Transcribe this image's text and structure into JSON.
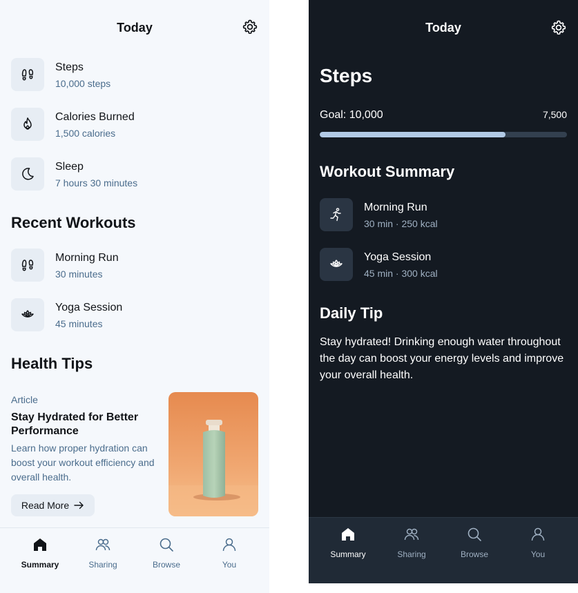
{
  "light": {
    "title": "Today",
    "metrics": [
      {
        "icon": "footprints-icon",
        "title": "Steps",
        "sub": "10,000 steps"
      },
      {
        "icon": "flame-icon",
        "title": "Calories Burned",
        "sub": "1,500 calories"
      },
      {
        "icon": "moon-icon",
        "title": "Sleep",
        "sub": "7 hours 30 minutes"
      }
    ],
    "recent_heading": "Recent Workouts",
    "workouts": [
      {
        "icon": "footprints-icon",
        "title": "Morning Run",
        "sub": "30 minutes"
      },
      {
        "icon": "lotus-icon",
        "title": "Yoga Session",
        "sub": "45 minutes"
      }
    ],
    "tips_heading": "Health Tips",
    "article": {
      "kicker": "Article",
      "title": "Stay Hydrated for Better Performance",
      "description": "Learn how proper hydration can boost your workout efficiency and overall health.",
      "button": "Read More"
    },
    "nav": [
      {
        "label": "Summary",
        "icon": "home-icon",
        "active": true
      },
      {
        "label": "Sharing",
        "icon": "users-icon",
        "active": false
      },
      {
        "label": "Browse",
        "icon": "search-icon",
        "active": false
      },
      {
        "label": "You",
        "icon": "user-icon",
        "active": false
      }
    ]
  },
  "dark": {
    "title": "Today",
    "steps_heading": "Steps",
    "goal_label": "Goal: 10,000",
    "goal_value": "7,500",
    "progress_fraction": 0.75,
    "summary_heading": "Workout Summary",
    "workouts": [
      {
        "icon": "running-person-icon",
        "title": "Morning Run",
        "sub": "30 min · 250 kcal"
      },
      {
        "icon": "lotus-icon",
        "title": "Yoga Session",
        "sub": "45 min · 300 kcal"
      }
    ],
    "tip_heading": "Daily Tip",
    "tip_text": "Stay hydrated! Drinking enough water throughout the day can boost your energy levels and improve your overall health.",
    "nav": [
      {
        "label": "Summary",
        "icon": "home-icon",
        "active": true
      },
      {
        "label": "Sharing",
        "icon": "users-icon",
        "active": false
      },
      {
        "label": "Browse",
        "icon": "search-icon",
        "active": false
      },
      {
        "label": "You",
        "icon": "user-icon",
        "active": false
      }
    ]
  },
  "colors": {
    "light_bg": "#f5f8fc",
    "dark_bg": "#141a22",
    "accent_text": "#4a6c8c",
    "progress_fill": "#b2cae6"
  }
}
